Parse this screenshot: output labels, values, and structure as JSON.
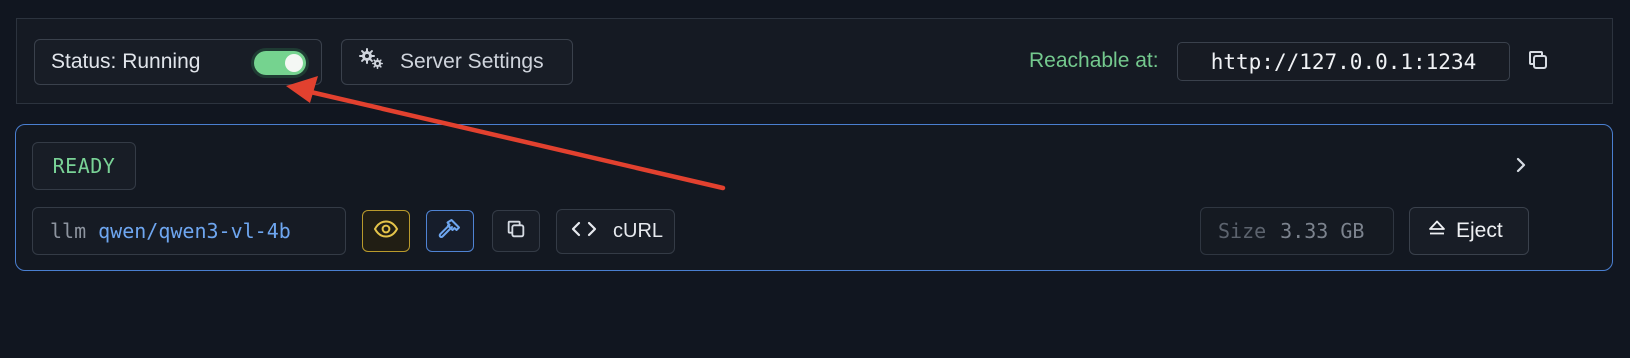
{
  "server": {
    "status_label": "Status: Running",
    "running": true,
    "settings_label": "Server Settings",
    "reachable_label": "Reachable at:",
    "url": "http://127.0.0.1:1234",
    "icons": {
      "settings": "gears-icon",
      "copy": "copy-icon"
    }
  },
  "model": {
    "state": "READY",
    "type": "llm",
    "name": "qwen/qwen3-vl-4b",
    "curl_label": "cURL",
    "size_label": "Size",
    "size_value": "3.33 GB",
    "eject_label": "Eject",
    "icons": {
      "expand": "chevron-right-icon",
      "vision": "eye-icon",
      "tool_use": "hammer-icon",
      "copy": "copy-icon",
      "code": "code-brackets-icon",
      "eject": "eject-icon"
    }
  },
  "colors": {
    "background": "#111620",
    "accent_green": "#75d38f",
    "accent_blue": "#4f83d3",
    "vision_yellow": "#e5c44a",
    "annotation_red": "#e2412f"
  }
}
